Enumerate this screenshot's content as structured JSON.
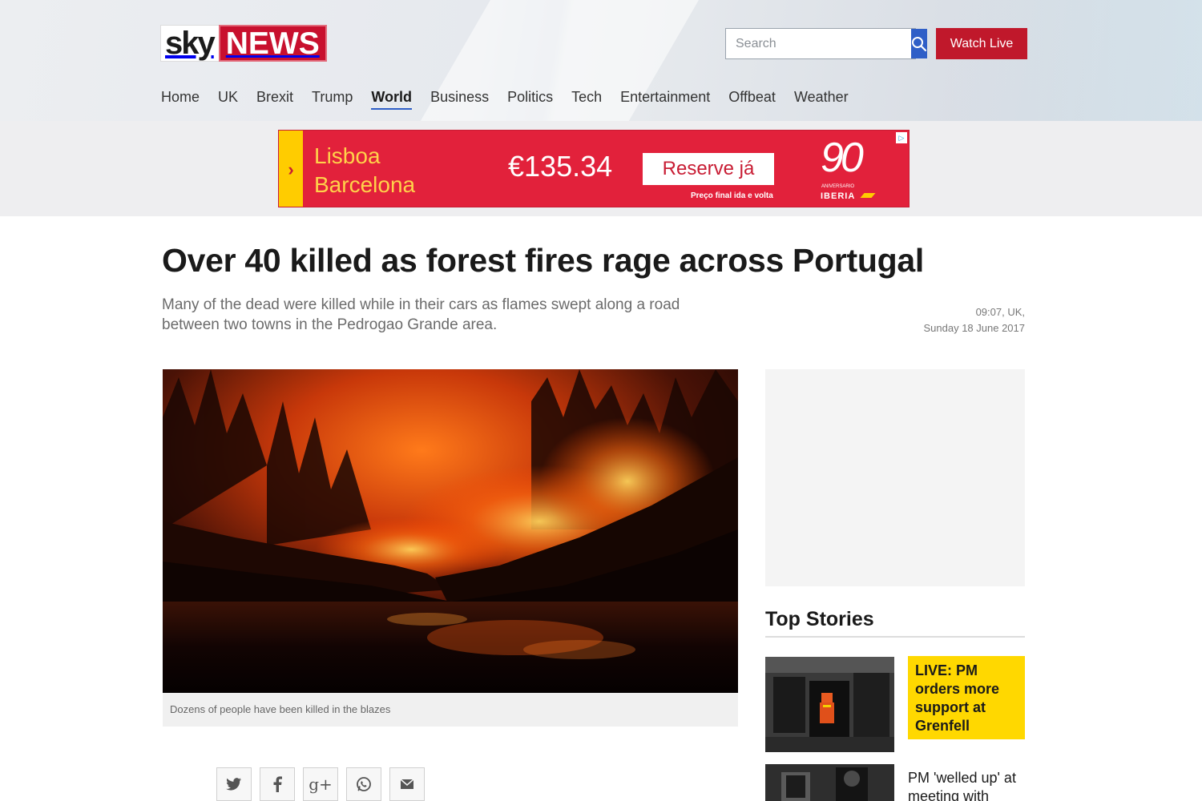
{
  "header": {
    "logo_sky": "sky",
    "logo_news": "NEWS",
    "search_placeholder": "Search",
    "watch_live": "Watch Live",
    "nav": [
      "Home",
      "UK",
      "Brexit",
      "Trump",
      "World",
      "Business",
      "Politics",
      "Tech",
      "Entertainment",
      "Offbeat",
      "Weather"
    ],
    "active_nav": "World"
  },
  "ad": {
    "city1": "Lisboa",
    "city2": "Barcelona",
    "price": "€135.34",
    "cta": "Reserve já",
    "note": "Preço final ida e volta",
    "anniversary_number": "90",
    "anniversary_label": "ANIVERSARIO",
    "brand": "IBERIA"
  },
  "article": {
    "headline": "Over 40 killed as forest fires rage across Portugal",
    "standfirst": "Many of the dead were killed while in their cars as flames swept along a road between two towns in the Pedrogao Grande area.",
    "time": "09:07, UK,",
    "date": "Sunday 18 June 2017",
    "image_caption": "Dozens of people have been killed in the blazes"
  },
  "share_icons": [
    "twitter-icon",
    "facebook-icon",
    "google-plus-icon",
    "whatsapp-icon",
    "email-icon"
  ],
  "sidebar": {
    "top_stories_title": "Top Stories",
    "stories": [
      {
        "title": "LIVE: PM orders more support at Grenfell",
        "highlight": true
      },
      {
        "title": "PM 'welled up' at meeting with",
        "highlight": false
      }
    ]
  },
  "colors": {
    "brand_red": "#c0182b",
    "search_blue": "#2f5fc7",
    "highlight_yellow": "#ffd800",
    "ad_red": "#e2213b"
  }
}
